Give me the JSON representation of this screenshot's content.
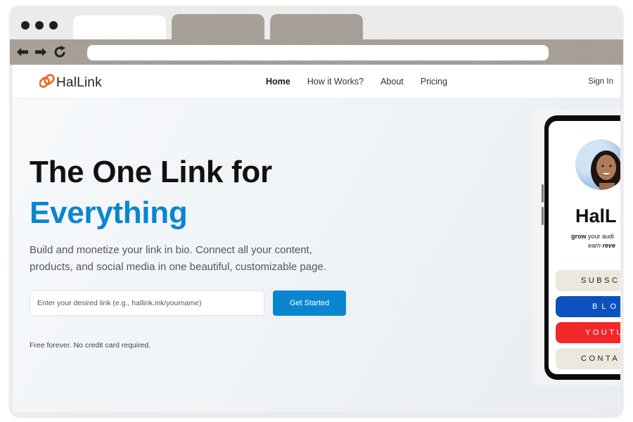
{
  "site": {
    "logo_text": "HalLink",
    "nav": [
      "Home",
      "How it Works?",
      "About",
      "Pricing"
    ],
    "sign_in": "Sign In"
  },
  "hero": {
    "title_line1": "The One Link for",
    "title_line2": "Everything",
    "subtitle": "Build and monetize your link in bio. Connect all your content, products, and social media in one beautiful, customizable page.",
    "input_placeholder": "Enter your desired link (e.g., hallink.ink/yourname)",
    "cta_label": "Get Started",
    "note": "Free forever. No credit card required."
  },
  "phone": {
    "brand": "HalL",
    "tagline_bold": "grow",
    "tagline_rest": " your audi",
    "tagline2_pre": "earn ",
    "tagline2_bold": "reve",
    "buttons": [
      "SUBSCRI",
      "BLOG",
      "YOUTU",
      "CONTA"
    ]
  },
  "colors": {
    "accent": "#0a86d0",
    "logo_orange": "#f0631a",
    "blog_blue": "#0b52c0",
    "youtube_red": "#f0282a",
    "neutral_button": "#ece8dd"
  }
}
